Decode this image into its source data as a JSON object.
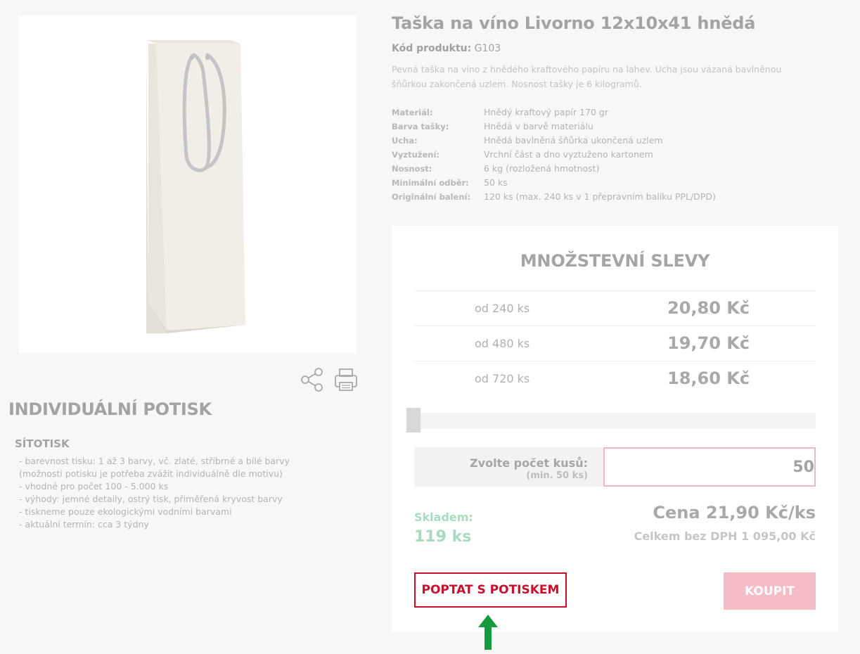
{
  "product": {
    "title": "Taška na víno Livorno 12x10x41 hnědá",
    "code_label": "Kód produktu:",
    "code_value": "G103",
    "description": "Pevná taška na víno z hnědého kraftového papíru na lahev. Ucha jsou vázaná bavlněnou šňůrkou zakončená uzlem. Nosnost tašky je 6 kilogramů.",
    "specs": [
      {
        "label": "Materiál:",
        "value": "Hnědý kraftový papír 170 gr"
      },
      {
        "label": "Barva tašky:",
        "value": "Hnědá v barvě materiálu"
      },
      {
        "label": "Ucha:",
        "value": "Hnědá bavlněná šňůrka ukončená uzlem"
      },
      {
        "label": "Vyztužení:",
        "value": "Vrchní část a dno vyztuženo kartonem"
      },
      {
        "label": "Nosnost:",
        "value": "6 kg (rozložená hmotnost)"
      },
      {
        "label": "Minimální odběr:",
        "value": "50 ks"
      },
      {
        "label": "Originální balení:",
        "value": "120 ks (max. 240 ks v 1 přepravním balíku PPL/DPD)"
      }
    ]
  },
  "tools": {
    "share_icon": "share-icon",
    "print_icon": "printer-icon"
  },
  "individual": {
    "title": "INDIVIDUÁLNÍ POTISK",
    "subtitle": "SÍTOTISK",
    "lines": [
      " - barevnost tisku: 1 až 3 barvy, vč. zlaté, stříbrné a bílé barvy",
      "(možnosti potisku je potřeba zvážit individuálně dle motivu)",
      " - vhodné pro počet 100 - 5.000 ks",
      " - výhody: jemné detaily, ostrý tisk, přiměřená kryvost barvy",
      " - tiskneme pouze ekologickými vodními barvami",
      " - aktuální termín: cca 3 týdny"
    ]
  },
  "discounts": {
    "title": "MNOŽSTEVNÍ SLEVY",
    "tiers": [
      {
        "qty": "od 240 ks",
        "price": "20,80 Kč"
      },
      {
        "qty": "od 480 ks",
        "price": "19,70 Kč"
      },
      {
        "qty": "od 720 ks",
        "price": "18,60 Kč"
      }
    ]
  },
  "order": {
    "slider_value": 50,
    "qty_label": "Zvolte počet kusů:",
    "qty_min": "(min. 50 ks)",
    "qty_value": "50",
    "stock_label": "Skladem:",
    "stock_value": "119 ks",
    "price": "Cena 21,90 Kč/ks",
    "total": "Celkem bez DPH 1 095,00 Kč",
    "inquire_button": "POPTAT S POTISKEM",
    "buy_button": "KOUPIT"
  },
  "colors": {
    "accent_red": "#c8102e",
    "buy_pink": "#f4bcc5",
    "stock_green": "#a7dcc0",
    "arrow_green": "#159a3c"
  }
}
